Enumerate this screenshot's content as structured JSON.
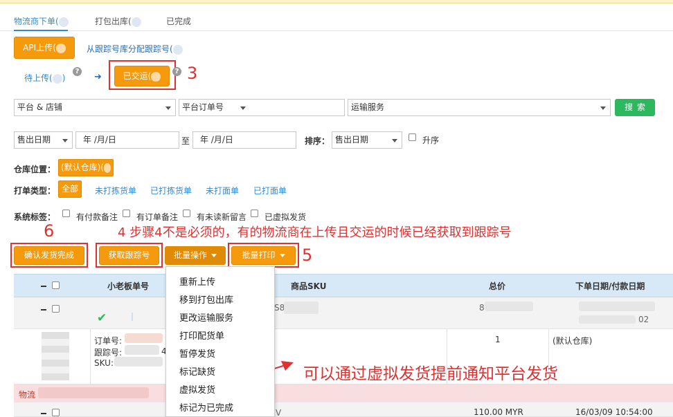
{
  "tabs": [
    {
      "label": "物流商下单("
    },
    {
      "label": "打包出库("
    },
    {
      "label": "已完成"
    }
  ],
  "subtabs": {
    "api_upload": "API上传(",
    "assign_tracking": "从跟踪号库分配跟踪号("
  },
  "steps": {
    "pending_upload": "待上传(",
    "pending_suffix": ")",
    "arrow": "➜",
    "shipped": "已交运(",
    "help": "?"
  },
  "annotations": {
    "n3": "3",
    "n4_text": "4 步骤4不是必须的，有的物流商在上传且交运的时候已经获取到跟踪号",
    "n5": "5",
    "n6": "6",
    "virtual_note": "可以通过虚拟发货提前通知平台发货"
  },
  "filters": {
    "platform_shop": "平台 & 店铺",
    "platform_order": "平台订单号",
    "shipping_service": "运输服务",
    "search_btn": "搜索",
    "date_type": "售出日期",
    "date_from": "年 /月/日",
    "to": "至",
    "date_to": "年 /月/日",
    "sort_label": "排序：",
    "sort_by": "售出日期",
    "ascending": "升序"
  },
  "warehouse": {
    "label": "仓库位置：",
    "value": "(默认仓库)("
  },
  "print_type": {
    "label": "打单类型：",
    "options": [
      "全部",
      "未打拣货单",
      "已打拣货单",
      "未打面单",
      "已打面单"
    ]
  },
  "system_tags": {
    "label": "系统标签：",
    "options": [
      "有付款备注",
      "有订单备注",
      "有未读新留言",
      "已虚拟发货"
    ]
  },
  "actions": {
    "confirm_ship": "确认发货完成",
    "get_tracking": "获取跟踪号",
    "batch_ops": "批量操作",
    "batch_print": "批量打印"
  },
  "table": {
    "headers": [
      "小老板单号",
      "商品SKU",
      "总价",
      "下单日期/付款日期"
    ],
    "row1_sku_fragment": "S8",
    "row1_price_fragment": "8",
    "row1_date_fragment": "02",
    "detail_order_label": "订单号:",
    "detail_tracking_label": "跟踪号:",
    "detail_tracking_fragment": "4",
    "detail_sku_label": "SKU:",
    "detail_qty": "1",
    "detail_warehouse": "(默认仓库)",
    "logistics_label": "物流",
    "row3_price": "110.00 MYR",
    "row3_date": "16/03/09 10:54:00",
    "row3_fragment": "V"
  },
  "batch_menu": [
    "重新上传",
    "移到打包出库",
    "更改运输服务",
    "打印配货单",
    "暂停发货",
    "标记缺货",
    "虚拟发货",
    "标记为已完成"
  ],
  "colors": {
    "accent_orange": "#f59a0c",
    "link_blue": "#2f8ad1",
    "search_green": "#2cb85c",
    "annotation_red": "#e03030",
    "header_blue": "#d7e9f7"
  }
}
